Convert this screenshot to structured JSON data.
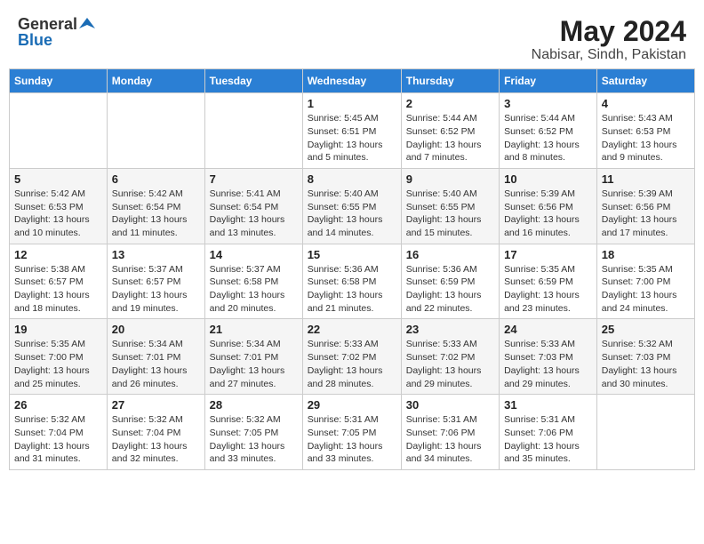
{
  "logo": {
    "general": "General",
    "blue": "Blue"
  },
  "title": {
    "month": "May 2024",
    "location": "Nabisar, Sindh, Pakistan"
  },
  "days_of_week": [
    "Sunday",
    "Monday",
    "Tuesday",
    "Wednesday",
    "Thursday",
    "Friday",
    "Saturday"
  ],
  "weeks": [
    [
      {
        "day": "",
        "info": ""
      },
      {
        "day": "",
        "info": ""
      },
      {
        "day": "",
        "info": ""
      },
      {
        "day": "1",
        "info": "Sunrise: 5:45 AM\nSunset: 6:51 PM\nDaylight: 13 hours\nand 5 minutes."
      },
      {
        "day": "2",
        "info": "Sunrise: 5:44 AM\nSunset: 6:52 PM\nDaylight: 13 hours\nand 7 minutes."
      },
      {
        "day": "3",
        "info": "Sunrise: 5:44 AM\nSunset: 6:52 PM\nDaylight: 13 hours\nand 8 minutes."
      },
      {
        "day": "4",
        "info": "Sunrise: 5:43 AM\nSunset: 6:53 PM\nDaylight: 13 hours\nand 9 minutes."
      }
    ],
    [
      {
        "day": "5",
        "info": "Sunrise: 5:42 AM\nSunset: 6:53 PM\nDaylight: 13 hours\nand 10 minutes."
      },
      {
        "day": "6",
        "info": "Sunrise: 5:42 AM\nSunset: 6:54 PM\nDaylight: 13 hours\nand 11 minutes."
      },
      {
        "day": "7",
        "info": "Sunrise: 5:41 AM\nSunset: 6:54 PM\nDaylight: 13 hours\nand 13 minutes."
      },
      {
        "day": "8",
        "info": "Sunrise: 5:40 AM\nSunset: 6:55 PM\nDaylight: 13 hours\nand 14 minutes."
      },
      {
        "day": "9",
        "info": "Sunrise: 5:40 AM\nSunset: 6:55 PM\nDaylight: 13 hours\nand 15 minutes."
      },
      {
        "day": "10",
        "info": "Sunrise: 5:39 AM\nSunset: 6:56 PM\nDaylight: 13 hours\nand 16 minutes."
      },
      {
        "day": "11",
        "info": "Sunrise: 5:39 AM\nSunset: 6:56 PM\nDaylight: 13 hours\nand 17 minutes."
      }
    ],
    [
      {
        "day": "12",
        "info": "Sunrise: 5:38 AM\nSunset: 6:57 PM\nDaylight: 13 hours\nand 18 minutes."
      },
      {
        "day": "13",
        "info": "Sunrise: 5:37 AM\nSunset: 6:57 PM\nDaylight: 13 hours\nand 19 minutes."
      },
      {
        "day": "14",
        "info": "Sunrise: 5:37 AM\nSunset: 6:58 PM\nDaylight: 13 hours\nand 20 minutes."
      },
      {
        "day": "15",
        "info": "Sunrise: 5:36 AM\nSunset: 6:58 PM\nDaylight: 13 hours\nand 21 minutes."
      },
      {
        "day": "16",
        "info": "Sunrise: 5:36 AM\nSunset: 6:59 PM\nDaylight: 13 hours\nand 22 minutes."
      },
      {
        "day": "17",
        "info": "Sunrise: 5:35 AM\nSunset: 6:59 PM\nDaylight: 13 hours\nand 23 minutes."
      },
      {
        "day": "18",
        "info": "Sunrise: 5:35 AM\nSunset: 7:00 PM\nDaylight: 13 hours\nand 24 minutes."
      }
    ],
    [
      {
        "day": "19",
        "info": "Sunrise: 5:35 AM\nSunset: 7:00 PM\nDaylight: 13 hours\nand 25 minutes."
      },
      {
        "day": "20",
        "info": "Sunrise: 5:34 AM\nSunset: 7:01 PM\nDaylight: 13 hours\nand 26 minutes."
      },
      {
        "day": "21",
        "info": "Sunrise: 5:34 AM\nSunset: 7:01 PM\nDaylight: 13 hours\nand 27 minutes."
      },
      {
        "day": "22",
        "info": "Sunrise: 5:33 AM\nSunset: 7:02 PM\nDaylight: 13 hours\nand 28 minutes."
      },
      {
        "day": "23",
        "info": "Sunrise: 5:33 AM\nSunset: 7:02 PM\nDaylight: 13 hours\nand 29 minutes."
      },
      {
        "day": "24",
        "info": "Sunrise: 5:33 AM\nSunset: 7:03 PM\nDaylight: 13 hours\nand 29 minutes."
      },
      {
        "day": "25",
        "info": "Sunrise: 5:32 AM\nSunset: 7:03 PM\nDaylight: 13 hours\nand 30 minutes."
      }
    ],
    [
      {
        "day": "26",
        "info": "Sunrise: 5:32 AM\nSunset: 7:04 PM\nDaylight: 13 hours\nand 31 minutes."
      },
      {
        "day": "27",
        "info": "Sunrise: 5:32 AM\nSunset: 7:04 PM\nDaylight: 13 hours\nand 32 minutes."
      },
      {
        "day": "28",
        "info": "Sunrise: 5:32 AM\nSunset: 7:05 PM\nDaylight: 13 hours\nand 33 minutes."
      },
      {
        "day": "29",
        "info": "Sunrise: 5:31 AM\nSunset: 7:05 PM\nDaylight: 13 hours\nand 33 minutes."
      },
      {
        "day": "30",
        "info": "Sunrise: 5:31 AM\nSunset: 7:06 PM\nDaylight: 13 hours\nand 34 minutes."
      },
      {
        "day": "31",
        "info": "Sunrise: 5:31 AM\nSunset: 7:06 PM\nDaylight: 13 hours\nand 35 minutes."
      },
      {
        "day": "",
        "info": ""
      }
    ]
  ]
}
